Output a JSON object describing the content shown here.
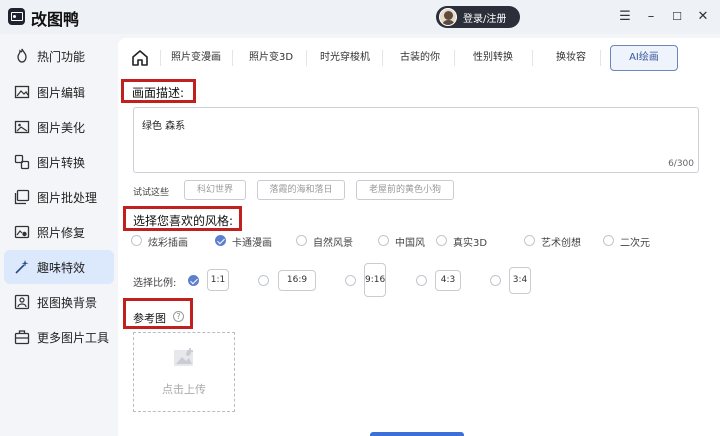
{
  "app": {
    "title": "改图鸭",
    "login_label": "登录/注册"
  },
  "window_controls": {
    "menu": "☰",
    "minimize": "–",
    "maximize": "☐",
    "close": "✕"
  },
  "sidebar": {
    "items": [
      {
        "label": "热门功能",
        "icon": "flame-icon"
      },
      {
        "label": "图片编辑",
        "icon": "image-edit-icon"
      },
      {
        "label": "图片美化",
        "icon": "image-beautify-icon"
      },
      {
        "label": "图片转换",
        "icon": "convert-icon"
      },
      {
        "label": "图片批处理",
        "icon": "batch-icon"
      },
      {
        "label": "照片修复",
        "icon": "photo-repair-icon"
      },
      {
        "label": "趣味特效",
        "icon": "magic-wand-icon",
        "active": true
      },
      {
        "label": "抠图换背景",
        "icon": "cutout-icon"
      },
      {
        "label": "更多图片工具",
        "icon": "toolbox-icon"
      }
    ]
  },
  "tabs": [
    {
      "label": "照片变漫画"
    },
    {
      "label": "照片变3D"
    },
    {
      "label": "时光穿梭机"
    },
    {
      "label": "古装的你"
    },
    {
      "label": "性别转换"
    },
    {
      "label": "换妆容"
    },
    {
      "label": "AI绘画",
      "active": true
    }
  ],
  "description": {
    "heading": "画面描述:",
    "value": "绿色 森系",
    "char_count": "6/300",
    "try_label": "试试这些",
    "suggestions": [
      "科幻世界",
      "落霞的海和落日",
      "老屋前的黄色小狗"
    ]
  },
  "style": {
    "heading": "选择您喜欢的风格:",
    "options": [
      {
        "label": "炫彩插画",
        "selected": false
      },
      {
        "label": "卡通漫画",
        "selected": true
      },
      {
        "label": "自然风景",
        "selected": false
      },
      {
        "label": "中国风",
        "selected": false
      },
      {
        "label": "真实3D",
        "selected": false
      },
      {
        "label": "艺术创想",
        "selected": false
      },
      {
        "label": "二次元",
        "selected": false
      }
    ]
  },
  "ratio": {
    "label": "选择比例:",
    "options": [
      {
        "label": "1:1",
        "selected": true
      },
      {
        "label": "16:9",
        "selected": false
      },
      {
        "label": "9:16",
        "selected": false
      },
      {
        "label": "4:3",
        "selected": false
      },
      {
        "label": "3:4",
        "selected": false
      }
    ]
  },
  "reference": {
    "heading": "参考图",
    "help_symbol": "?",
    "upload_label": "点击上传"
  },
  "colors": {
    "accent": "#5d7fd0",
    "highlight_box": "#c0211f",
    "active_sidebar_bg": "#dce8fb"
  }
}
